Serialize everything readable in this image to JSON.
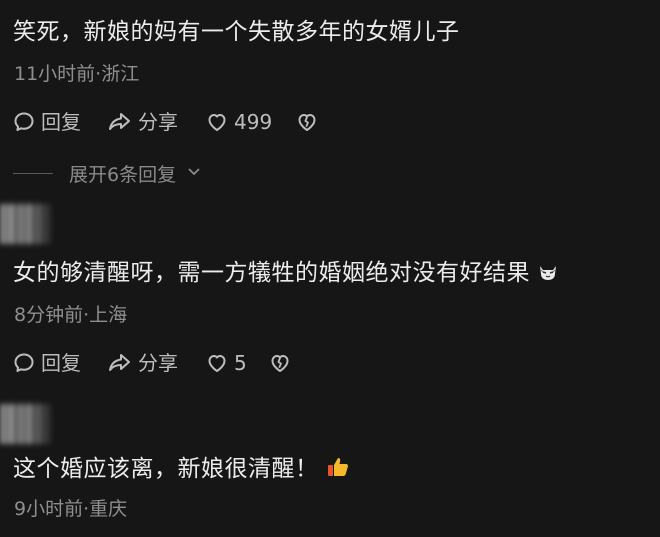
{
  "comments": [
    {
      "text": "笑死，新娘的妈有一个失散多年的女婿儿子",
      "meta": "11小时前·浙江",
      "reply_label": "回复",
      "share_label": "分享",
      "likes": "499",
      "expand_label": "展开6条回复"
    },
    {
      "text": "女的够清醒呀，需一方犠牲的婚姻绝对没有好结果",
      "meta": "8分钟前·上海",
      "reply_label": "回复",
      "share_label": "分享",
      "likes": "5",
      "emoji_icon": "cat-face-icon"
    },
    {
      "text": "这个婚应该离，新娘很清醒！",
      "meta": "9小时前·重庆",
      "emoji_icon": "thumbs-up-icon"
    }
  ],
  "colors": {
    "background": "#161616",
    "text": "#ececec",
    "meta": "#8f8f8f",
    "action": "#bdbdbd",
    "thumb": "#f5b82a"
  }
}
